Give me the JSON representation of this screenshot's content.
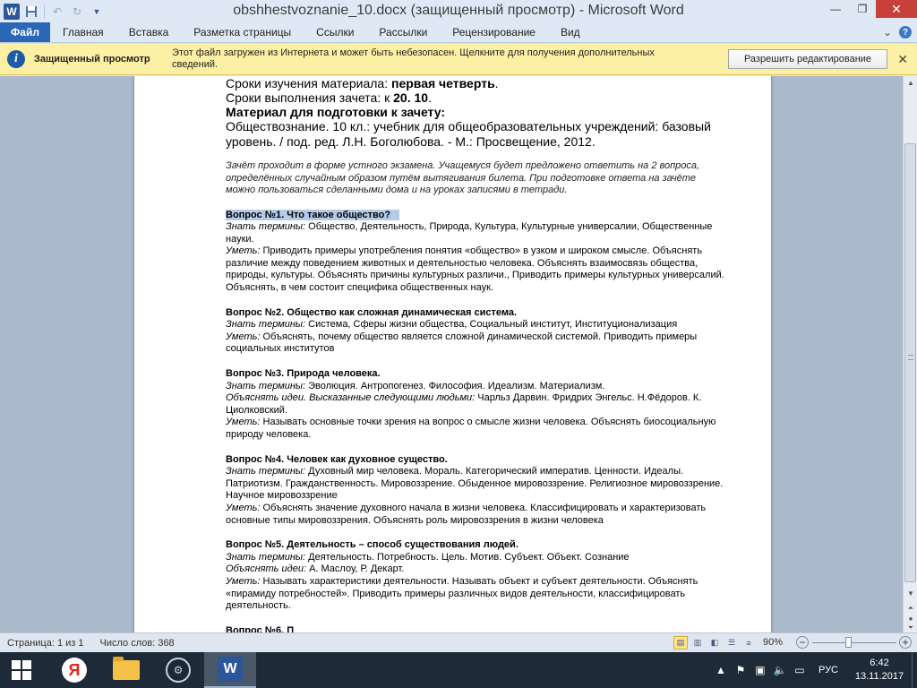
{
  "window": {
    "title": "obshhestvoznanie_10.docx (защищенный просмотр)  -  Microsoft Word",
    "app_icon": "W",
    "colors": {
      "file_tab": "#2b67b7",
      "close": "#c7413a",
      "protected_bar": "#fcf0a4"
    }
  },
  "ribbon": {
    "file_tab": "Файл",
    "tabs": [
      "Главная",
      "Вставка",
      "Разметка страницы",
      "Ссылки",
      "Рассылки",
      "Рецензирование",
      "Вид"
    ]
  },
  "protected_view": {
    "title": "Защищенный просмотр",
    "message": "Этот файл загружен из Интернета и может быть небезопасен. Щелкните для получения дополнительных сведений.",
    "button": "Разрешить редактирование"
  },
  "document": {
    "line1_label": "Сроки изучения материала:  ",
    "line1_value": "первая четверть",
    "line1_end": ".",
    "line2_label": "Сроки выполнения зачета:  к ",
    "line2_value": "20. 10",
    "line2_end": ".",
    "material_heading": "Материал для подготовки к зачету:",
    "textbook": "Обществознание. 10 кл.: учебник для общеобразовательных  учреждений: базовый уровень. / под. ред. Л.Н. Боголюбова.  - М.: Просвещение, 2012.",
    "intro": "Зачёт проходит в форме устного экзамена. Учащемуся будет предложено ответить на 2 вопроса, определённых случайным образом путём вытягивания билета. При подготовке ответа на зачёте можно пользоваться сделанными дома и на уроках записями в тетради.",
    "questions": [
      {
        "title": "Вопрос №1. Что такое общество?",
        "know_label": "Знать термины:",
        "know": " Общество, Деятельность, Природа, Культура, Культурные универсалии, Общественные науки.",
        "ideas_label": "",
        "ideas": "",
        "can_label": "Уметь:",
        "can": " Приводить примеры употребления понятия «общество» в узком и широком смысле. Объяснять различие между поведением животных и деятельностью человека. Объяснять взаимосвязь общества, природы, культуры. Объяснять причины культурных различи., Приводить примеры культурных универсалий. Объяснять, в чем  состоит специфика общественных наук."
      },
      {
        "title": "Вопрос №2. Общество как сложная динамическая система.",
        "know_label": "Знать термины:",
        "know": " Система, Сферы жизни общества, Социальный институт, Институционализация",
        "ideas_label": "",
        "ideas": "",
        "can_label": "Уметь:",
        "can": " Объяснять, почему общество является сложной динамической системой. Приводить примеры социальных институтов"
      },
      {
        "title": "Вопрос №3. Природа человека.",
        "know_label": "Знать термины:",
        "know": " Эволюция. Антропогенез. Философия. Идеализм. Материализм.",
        "ideas_label": "Объяснять идеи. Высказанные следующими людьми:",
        "ideas": " Чарльз Дарвин. Фридрих Энгельс. Н.Фёдоров. К. Циолковский.",
        "can_label": "Уметь:",
        "can": " Называть основные точки зрения на вопрос о смысле жизни человека. Объяснять биосоциальную природу человека."
      },
      {
        "title": "Вопрос №4. Человек как духовное существо.",
        "know_label": "Знать термины:",
        "know": "   Духовный мир человека. Мораль. Категорический императив. Ценности. Идеалы. Патриотизм. Гражданственность. Мировоззрение. Обыденное мировоззрение. Религиозное мировоззрение. Научное мировоззрение",
        "ideas_label": "",
        "ideas": "",
        "can_label": "Уметь:",
        "can": "  Объяснять значение духовного начала в жизни человека. Классифицировать и характеризовать основные типы мировоззрения. Объяснять роль мировоззрения в жизни человека"
      },
      {
        "title": "Вопрос №5. Деятельность – способ существования людей.",
        "know_label": "Знать термины:",
        "know": " Деятельность. Потребность. Цель. Мотив. Субъект. Объект. Сознание",
        "ideas_label": "Объяснять идеи:",
        "ideas": "  А. Маслоу, Р. Декарт.",
        "can_label": "Уметь:",
        "can": "  Называть характеристики деятельности. Называть объект и субъект деятельности. Объяснять «пирамиду потребностей». Приводить примеры различных видов деятельности, классифицировать деятельность."
      }
    ],
    "partial_next": "Вопрос №6. П"
  },
  "statusbar": {
    "page": "Страница: 1 из 1",
    "words": "Число слов: 368",
    "zoom": "90%"
  },
  "taskbar": {
    "lang": "РУС",
    "time": "6:42",
    "date": "13.11.2017"
  }
}
